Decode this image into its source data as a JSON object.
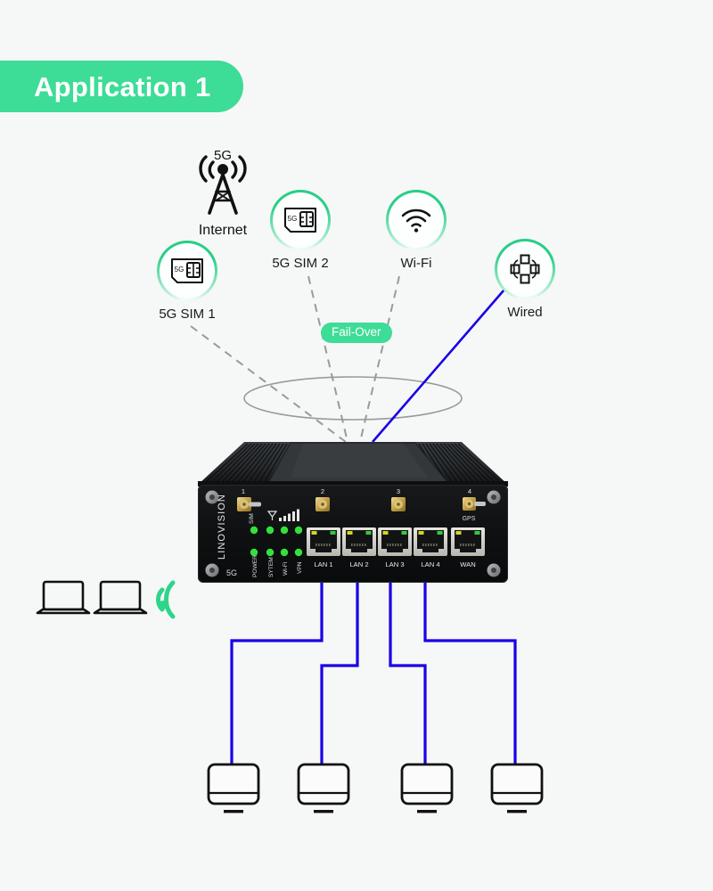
{
  "page": {
    "background": "#f6f7f7",
    "accent_green": "#3ddc97",
    "wired_blue": "#1800e6",
    "dash_gray": "#9a9a9a"
  },
  "header": {
    "badge_label": "Application 1"
  },
  "diagram": {
    "failover_badge": "Fail-Over",
    "uplinks": [
      {
        "id": "internet-tower",
        "label": "Internet",
        "icon": "cell-tower-5g-icon",
        "sublabel": "5G",
        "style": "plain"
      },
      {
        "id": "sim1",
        "label": "5G SIM 1",
        "icon": "sim-card-5g-icon",
        "style": "circle"
      },
      {
        "id": "sim2",
        "label": "5G SIM 2",
        "icon": "sim-card-5g-icon",
        "style": "circle"
      },
      {
        "id": "wifi",
        "label": "Wi-Fi",
        "icon": "wifi-icon",
        "style": "circle"
      },
      {
        "id": "wired",
        "label": "Wired",
        "icon": "network-nodes-icon",
        "style": "circle"
      }
    ],
    "link_types": {
      "wireless": "dashed-gray",
      "wired": "solid-blue"
    }
  },
  "router": {
    "brand": "LINOVISION",
    "tech_label": "5G",
    "antenna_ports": [
      {
        "number": "1",
        "caption": ""
      },
      {
        "number": "2",
        "caption": ""
      },
      {
        "number": "3",
        "caption": ""
      },
      {
        "number": "4",
        "caption": "GPS"
      }
    ],
    "leds_top": [
      {
        "label": "SIM",
        "icon": "sim-led",
        "color": "#2fdd3a"
      },
      {
        "label": "",
        "icon": "signal-bars-icon",
        "color": "#2fdd3a"
      },
      {
        "label": "",
        "icon": "signal-led",
        "color": "#2fdd3a"
      },
      {
        "label": "",
        "icon": "signal-led",
        "color": "#2fdd3a"
      }
    ],
    "leds_bottom": [
      {
        "label": "POWER",
        "color": "#2fdd3a"
      },
      {
        "label": "SYTEM",
        "color": "#2fdd3a"
      },
      {
        "label": "Wi-Fi",
        "color": "#2fdd3a"
      },
      {
        "label": "VPN",
        "color": "#2fdd3a"
      }
    ],
    "ethernet_ports": [
      {
        "label": "LAN 1"
      },
      {
        "label": "LAN 2"
      },
      {
        "label": "LAN 3"
      },
      {
        "label": "LAN 4"
      },
      {
        "label": "WAN"
      }
    ]
  },
  "clients": {
    "wireless_group": {
      "icon": "laptop-icon",
      "count": 2,
      "signal_icon": "wifi-signal-green-icon"
    },
    "wired_devices": [
      {
        "icon": "monitor-icon",
        "port": "LAN 1"
      },
      {
        "icon": "monitor-icon",
        "port": "LAN 2"
      },
      {
        "icon": "monitor-icon",
        "port": "LAN 3"
      },
      {
        "icon": "monitor-icon",
        "port": "LAN 4"
      }
    ]
  }
}
